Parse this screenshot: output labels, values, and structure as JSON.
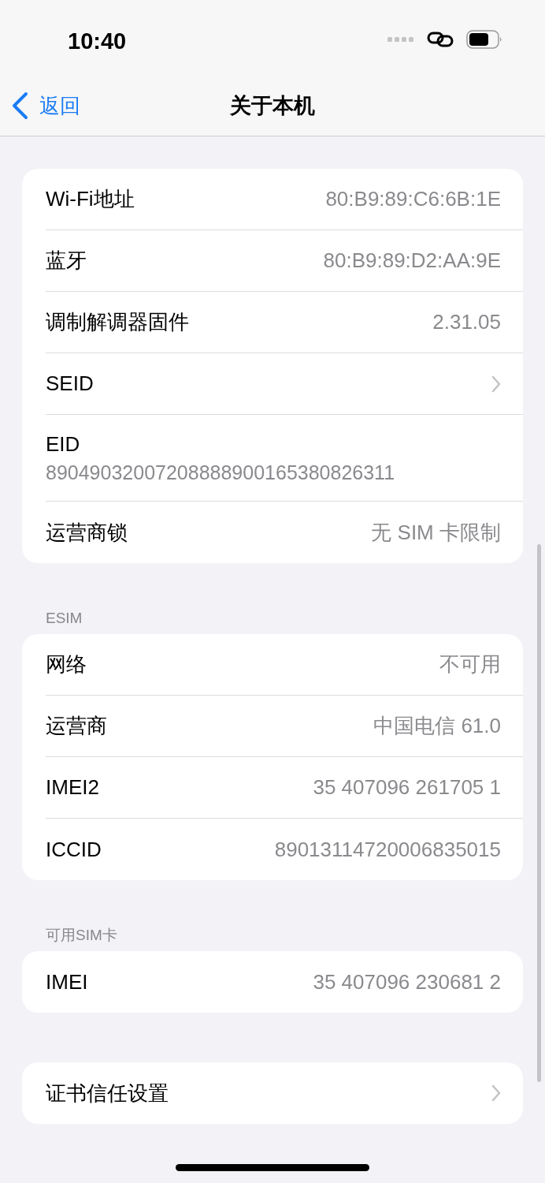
{
  "status_bar": {
    "time": "10:40"
  },
  "nav": {
    "back": "返回",
    "title": "关于本机"
  },
  "sections": [
    {
      "rows": [
        {
          "kind": "value",
          "label": "Wi-Fi地址",
          "value": "80:B9:89:C6:6B:1E"
        },
        {
          "kind": "value",
          "label": "蓝牙",
          "value": "80:B9:89:D2:AA:9E"
        },
        {
          "kind": "value",
          "label": "调制解调器固件",
          "value": "2.31.05"
        },
        {
          "kind": "link",
          "label": "SEID"
        },
        {
          "kind": "stacked",
          "label": "EID",
          "value": "89049032007208888900165380826311"
        },
        {
          "kind": "value",
          "label": "运营商锁",
          "value": "无 SIM 卡限制"
        }
      ]
    },
    {
      "header": "ESIM",
      "rows": [
        {
          "kind": "value",
          "label": "网络",
          "value": "不可用"
        },
        {
          "kind": "value",
          "label": "运营商",
          "value": "中国电信 61.0"
        },
        {
          "kind": "value",
          "label": "IMEI2",
          "value": "35 407096 261705 1"
        },
        {
          "kind": "value",
          "label": "ICCID",
          "value": "89013114720006835015"
        }
      ]
    },
    {
      "header": "可用SIM卡",
      "rows": [
        {
          "kind": "value",
          "label": "IMEI",
          "value": "35 407096 230681 2"
        }
      ]
    },
    {
      "rows": [
        {
          "kind": "link",
          "label": "证书信任设置"
        }
      ]
    }
  ]
}
